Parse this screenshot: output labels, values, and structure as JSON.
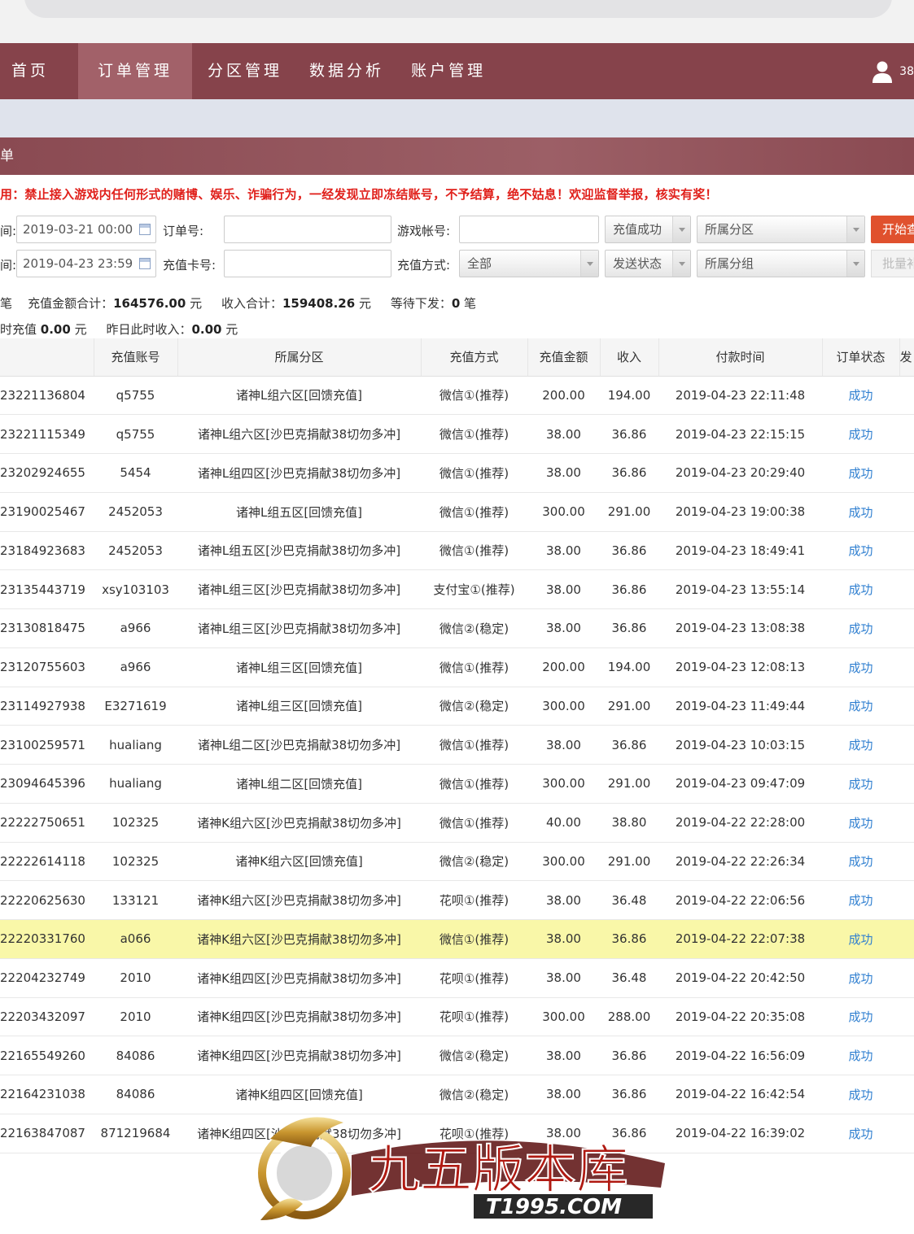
{
  "nav": {
    "items": [
      {
        "label": "首页"
      },
      {
        "label": "订单管理",
        "active": true
      },
      {
        "label": "分区管理"
      },
      {
        "label": "数据分析"
      },
      {
        "label": "账户管理"
      }
    ],
    "user_text": "38"
  },
  "panel": {
    "title": "单"
  },
  "warning": "用：禁止接入游戏内任何形式的赌博、娱乐、诈骗行为，一经发现立即冻结账号，不予结算，绝不姑息！欢迎监督举报，核实有奖！",
  "filters": {
    "start_label": "间:",
    "start_value": "2019-03-21 00:00",
    "end_label": "间:",
    "end_value": "2019-04-23 23:59",
    "order_label": "订单号:",
    "card_label": "充值卡号:",
    "account_label": "游戏帐号:",
    "method_label": "充值方式:",
    "method_value": "全部",
    "recharge_status": "充值成功",
    "send_status": "发送状态",
    "zone": "所属分区",
    "group": "所属分组",
    "start_button": "开始查",
    "batch_button": "批量补"
  },
  "summary": {
    "line1_prefix": "笔",
    "total_label": "充值金额合计：",
    "total_value": "164576.00",
    "unit": "元",
    "income_label": "收入合计：",
    "income_value": "159408.26",
    "pending_label": "等待下发：",
    "pending_value": "0",
    "pending_unit": "笔",
    "line2_prefix": "时充值",
    "today_value": "0.00",
    "yesterday_label": "昨日此时收入：",
    "yesterday_value": "0.00"
  },
  "table": {
    "headers": [
      "充值账号",
      "所属分区",
      "充值方式",
      "充值金额",
      "收入",
      "付款时间",
      "订单状态",
      "发"
    ],
    "rows": [
      [
        "23221136804",
        "q5755",
        "诸神L组六区[回馈充值]",
        "微信①(推荐)",
        "200.00",
        "194.00",
        "2019-04-23 22:11:48",
        "成功"
      ],
      [
        "23221115349",
        "q5755",
        "诸神L组六区[沙巴克捐献38切勿多冲]",
        "微信①(推荐)",
        "38.00",
        "36.86",
        "2019-04-23 22:15:15",
        "成功"
      ],
      [
        "23202924655",
        "5454",
        "诸神L组四区[沙巴克捐献38切勿多冲]",
        "微信①(推荐)",
        "38.00",
        "36.86",
        "2019-04-23 20:29:40",
        "成功"
      ],
      [
        "23190025467",
        "2452053",
        "诸神L组五区[回馈充值]",
        "微信①(推荐)",
        "300.00",
        "291.00",
        "2019-04-23 19:00:38",
        "成功"
      ],
      [
        "23184923683",
        "2452053",
        "诸神L组五区[沙巴克捐献38切勿多冲]",
        "微信①(推荐)",
        "38.00",
        "36.86",
        "2019-04-23 18:49:41",
        "成功"
      ],
      [
        "23135443719",
        "xsy103103",
        "诸神L组三区[沙巴克捐献38切勿多冲]",
        "支付宝①(推荐)",
        "38.00",
        "36.86",
        "2019-04-23 13:55:14",
        "成功"
      ],
      [
        "23130818475",
        "a966",
        "诸神L组三区[沙巴克捐献38切勿多冲]",
        "微信②(稳定)",
        "38.00",
        "36.86",
        "2019-04-23 13:08:38",
        "成功"
      ],
      [
        "23120755603",
        "a966",
        "诸神L组三区[回馈充值]",
        "微信①(推荐)",
        "200.00",
        "194.00",
        "2019-04-23 12:08:13",
        "成功"
      ],
      [
        "23114927938",
        "E3271619",
        "诸神L组三区[回馈充值]",
        "微信②(稳定)",
        "300.00",
        "291.00",
        "2019-04-23 11:49:44",
        "成功"
      ],
      [
        "23100259571",
        "hualiang",
        "诸神L组二区[沙巴克捐献38切勿多冲]",
        "微信①(推荐)",
        "38.00",
        "36.86",
        "2019-04-23 10:03:15",
        "成功"
      ],
      [
        "23094645396",
        "hualiang",
        "诸神L组二区[回馈充值]",
        "微信①(推荐)",
        "300.00",
        "291.00",
        "2019-04-23 09:47:09",
        "成功"
      ],
      [
        "22222750651",
        "102325",
        "诸神K组六区[沙巴克捐献38切勿多冲]",
        "微信①(推荐)",
        "40.00",
        "38.80",
        "2019-04-22 22:28:00",
        "成功"
      ],
      [
        "22222614118",
        "102325",
        "诸神K组六区[回馈充值]",
        "微信②(稳定)",
        "300.00",
        "291.00",
        "2019-04-22 22:26:34",
        "成功"
      ],
      [
        "22220625630",
        "133121",
        "诸神K组六区[沙巴克捐献38切勿多冲]",
        "花呗①(推荐)",
        "38.00",
        "36.48",
        "2019-04-22 22:06:56",
        "成功"
      ],
      [
        "22220331760",
        "a066",
        "诸神K组六区[沙巴克捐献38切勿多冲]",
        "微信①(推荐)",
        "38.00",
        "36.86",
        "2019-04-22 22:07:38",
        "成功"
      ],
      [
        "22204232749",
        "2010",
        "诸神K组四区[沙巴克捐献38切勿多冲]",
        "花呗①(推荐)",
        "38.00",
        "36.48",
        "2019-04-22 20:42:50",
        "成功"
      ],
      [
        "22203432097",
        "2010",
        "诸神K组四区[沙巴克捐献38切勿多冲]",
        "花呗①(推荐)",
        "300.00",
        "288.00",
        "2019-04-22 20:35:08",
        "成功"
      ],
      [
        "22165549260",
        "84086",
        "诸神K组四区[沙巴克捐献38切勿多冲]",
        "微信②(稳定)",
        "38.00",
        "36.86",
        "2019-04-22 16:56:09",
        "成功"
      ],
      [
        "22164231038",
        "84086",
        "诸神K组四区[回馈充值]",
        "微信②(稳定)",
        "38.00",
        "36.86",
        "2019-04-22 16:42:54",
        "成功"
      ],
      [
        "22163847087",
        "871219684",
        "诸神K组四区[沙巴克捐献38切勿多冲]",
        "花呗①(推荐)",
        "38.00",
        "36.86",
        "2019-04-22 16:39:02",
        "成功"
      ]
    ]
  },
  "watermark": {
    "text": "九五版本库",
    "domain": "T1995.COM"
  },
  "colors": {
    "nav_bg": "#86434b",
    "nav_active": "#a26169",
    "warning": "#e0201b",
    "status": "#2f7fd0",
    "highlight": "#f9f7a8",
    "start_button": "#e0512e"
  }
}
